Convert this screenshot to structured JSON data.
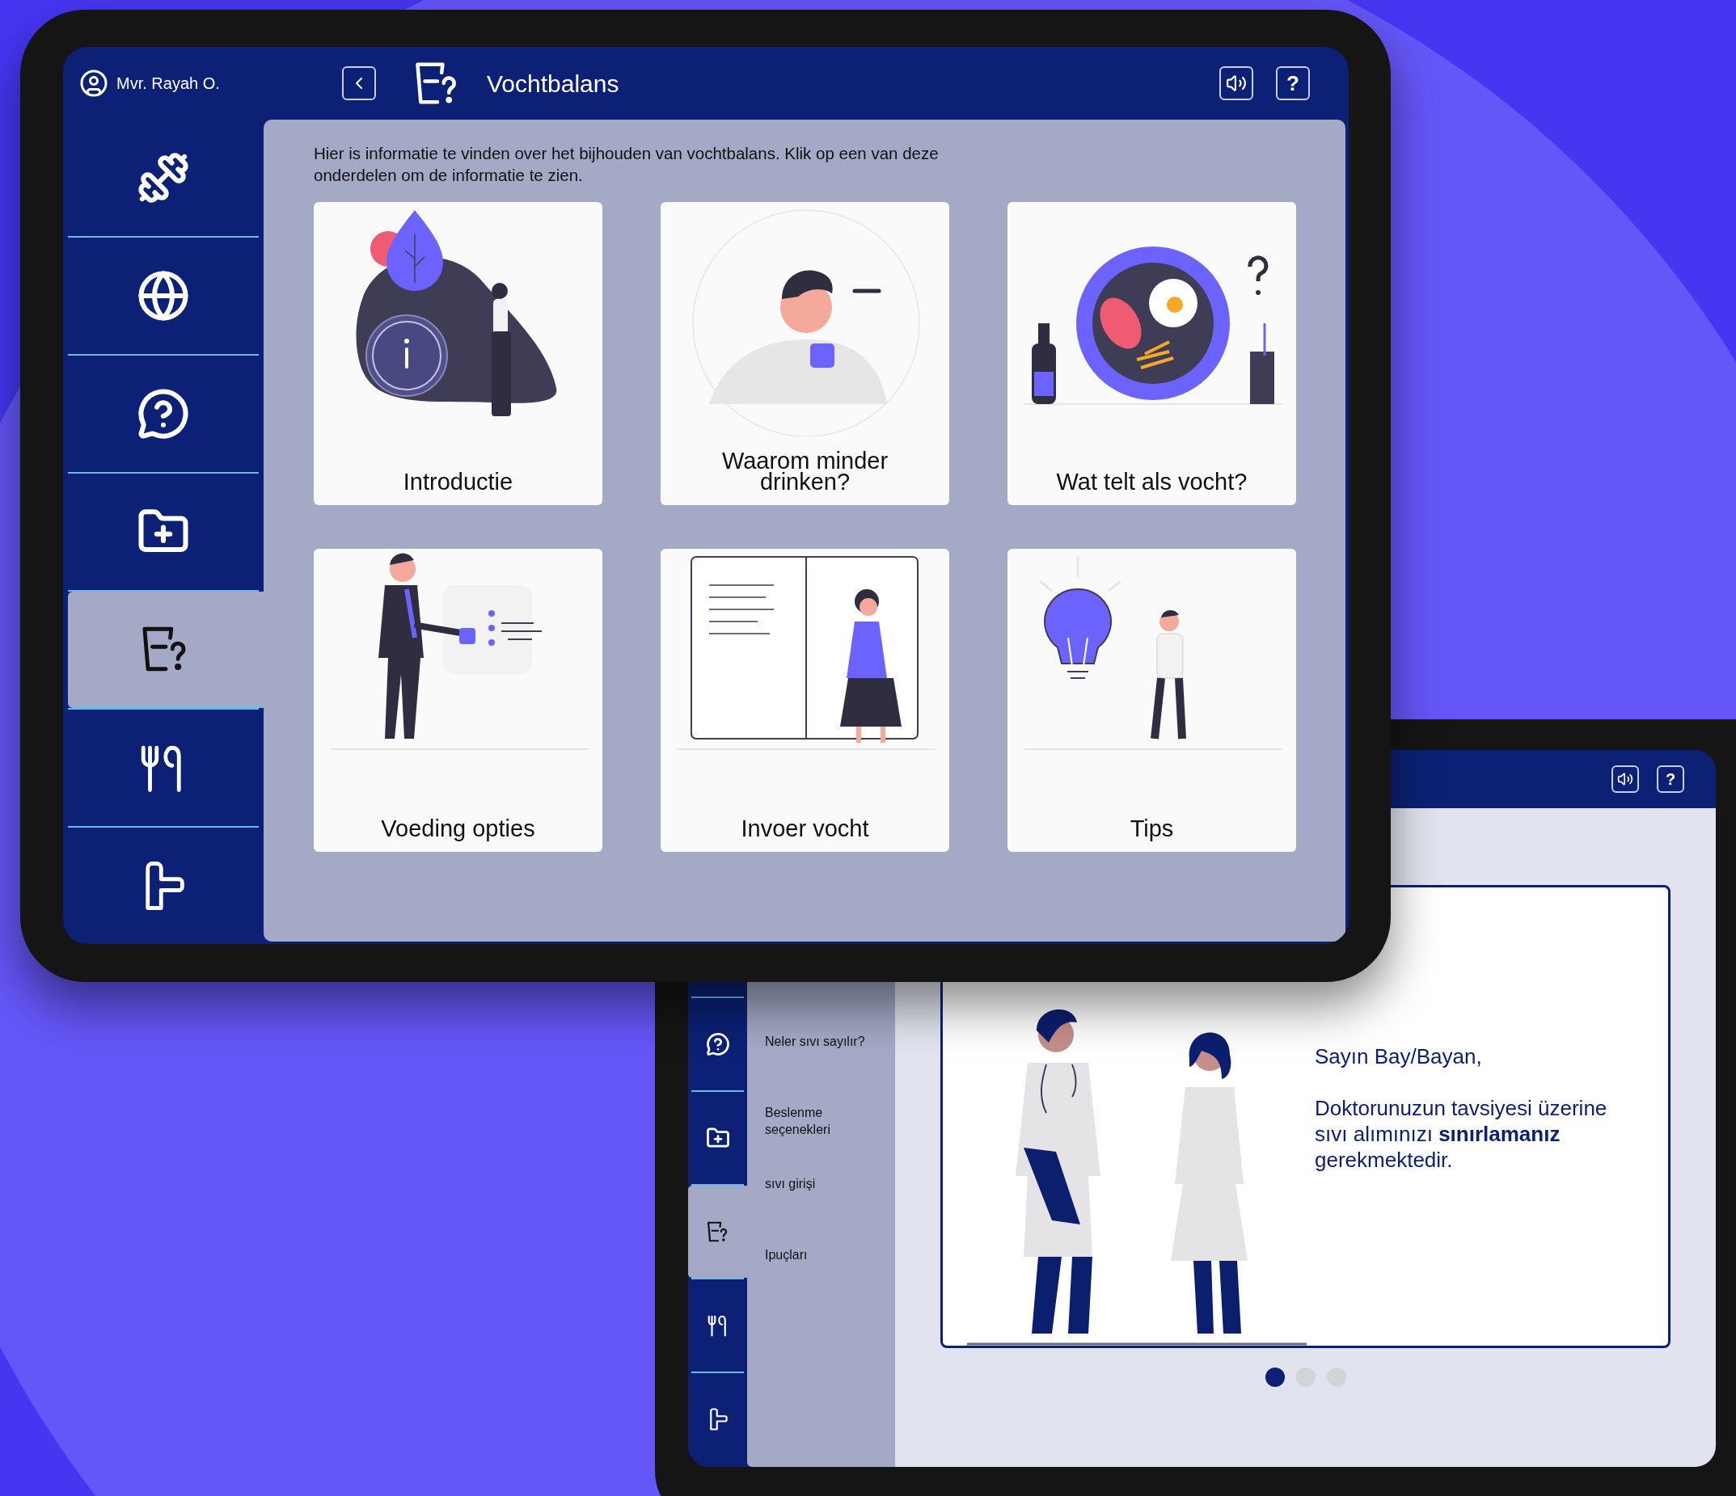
{
  "front": {
    "user": "Mvr. Rayah O.",
    "title": "Vochtbalans",
    "help": "?",
    "intro": "Hier is informatie te vinden over het bijhouden van vochtbalans. Klik op een van deze onderdelen om de informatie te zien.",
    "nav": [
      {
        "kind": "dumbbell",
        "selected": false
      },
      {
        "kind": "globe",
        "selected": false
      },
      {
        "kind": "question",
        "selected": false
      },
      {
        "kind": "folder",
        "selected": false
      },
      {
        "kind": "cup",
        "selected": true
      },
      {
        "kind": "cutlery",
        "selected": false
      },
      {
        "kind": "signpost",
        "selected": false
      }
    ],
    "cards": [
      {
        "kind": "intro",
        "label": "Introductie"
      },
      {
        "kind": "drink",
        "label": "Waarom minder drinken?"
      },
      {
        "kind": "plate",
        "label": "Wat telt als vocht?"
      },
      {
        "kind": "food",
        "label": "Voeding opties"
      },
      {
        "kind": "book",
        "label": "Invoer vocht"
      },
      {
        "kind": "bulb",
        "label": "Tips"
      }
    ]
  },
  "back": {
    "help": "?",
    "nav": [
      {
        "kind": "question",
        "selected": false
      },
      {
        "kind": "folder",
        "selected": false
      },
      {
        "kind": "cup",
        "selected": true
      },
      {
        "kind": "cutlery",
        "selected": false
      },
      {
        "kind": "signpost",
        "selected": false
      }
    ],
    "submenu": [
      "Neler sıvı sayılır?",
      "Beslenme seçenekleri",
      "sıvı girişi",
      "Ipuçları"
    ],
    "greeting": "Sayın Bay/Bayan,",
    "message": "Doktorunuzun tavsiyesi üzerine sıvı alımınızı **sınırlamanız** gerekmektedir.",
    "slides": [
      {
        "selected": true
      },
      {
        "selected": false
      },
      {
        "selected": false
      }
    ]
  }
}
